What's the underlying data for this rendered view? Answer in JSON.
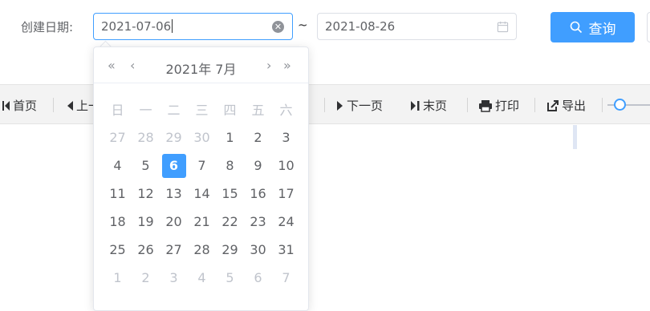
{
  "filter": {
    "label": "创建日期:",
    "start_date": "2021-07-06",
    "separator": "~",
    "end_date": "2021-08-26",
    "query_button": "查询"
  },
  "toolbar": {
    "items": [
      {
        "label": "首页",
        "icon": "first-page-icon"
      },
      {
        "label": "上一页",
        "icon": "previous-page-icon"
      },
      {
        "label": "下一页",
        "icon": "next-page-icon"
      },
      {
        "label": "末页",
        "icon": "last-page-icon"
      },
      {
        "label": "打印",
        "icon": "print-icon"
      },
      {
        "label": "导出",
        "icon": "export-icon"
      }
    ]
  },
  "datepicker": {
    "title": "2021年 7月",
    "nav": {
      "prev_year": "«",
      "prev_month": "‹",
      "next_month": "›",
      "next_year": "»"
    },
    "weekdays": [
      "日",
      "一",
      "二",
      "三",
      "四",
      "五",
      "六"
    ],
    "selected_day": "6",
    "weeks": [
      [
        "27",
        "28",
        "29",
        "30",
        "1",
        "2",
        "3"
      ],
      [
        "4",
        "5",
        "6",
        "7",
        "8",
        "9",
        "10"
      ],
      [
        "11",
        "12",
        "13",
        "14",
        "15",
        "16",
        "17"
      ],
      [
        "18",
        "19",
        "20",
        "21",
        "22",
        "23",
        "24"
      ],
      [
        "25",
        "26",
        "27",
        "28",
        "29",
        "30",
        "31"
      ],
      [
        "1",
        "2",
        "3",
        "4",
        "5",
        "6",
        "7"
      ]
    ]
  },
  "colors": {
    "accent": "#409eff",
    "muted": "#c0c4cc",
    "text": "#606266"
  }
}
